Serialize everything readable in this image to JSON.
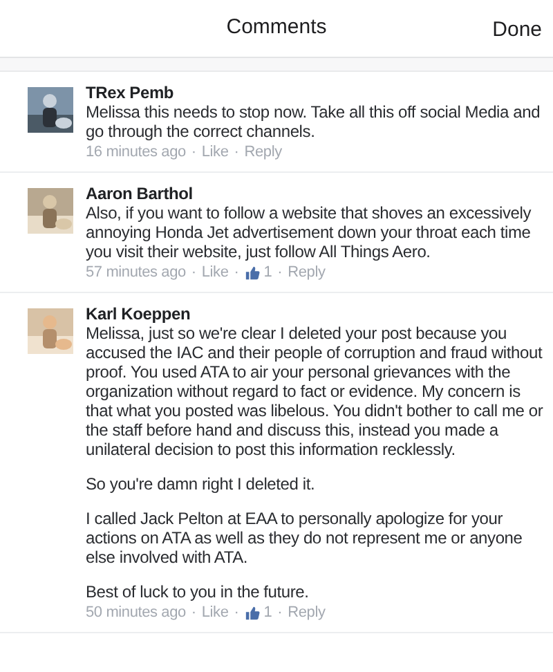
{
  "header": {
    "title": "Comments",
    "done_label": "Done"
  },
  "comments": [
    {
      "author": "TRex Pemb",
      "paragraphs": [
        "Melissa this needs to stop now. Take all this off social Media and go through the correct channels."
      ],
      "meta": [
        {
          "kind": "time",
          "text": "16 minutes ago"
        },
        {
          "kind": "sep",
          "text": "·"
        },
        {
          "kind": "link",
          "text": "Like"
        },
        {
          "kind": "sep",
          "text": "·"
        },
        {
          "kind": "link",
          "text": "Reply"
        }
      ]
    },
    {
      "author": "Aaron Barthol",
      "paragraphs": [
        "Also, if you want to follow a website that shoves an excessively annoying Honda Jet advertisement down your throat each time you visit their website, just follow All Things Aero."
      ],
      "meta": [
        {
          "kind": "time",
          "text": "57 minutes ago"
        },
        {
          "kind": "sep",
          "text": "·"
        },
        {
          "kind": "link",
          "text": "Like"
        },
        {
          "kind": "sep",
          "text": "·"
        },
        {
          "kind": "likes",
          "text": "1"
        },
        {
          "kind": "sep",
          "text": "·"
        },
        {
          "kind": "link",
          "text": "Reply"
        }
      ]
    },
    {
      "author": "Karl Koeppen",
      "paragraphs": [
        "Melissa, just so we're clear I deleted your post because you accused the IAC and their people of corruption and fraud without proof. You used ATA to air your personal grievances with the organization without regard to fact or evidence. My concern is that what you posted was libelous. You didn't bother to call me or the staff before hand and discuss this, instead you made a unilateral decision to post this information recklessly.",
        "So you're damn right I deleted it.",
        "I called Jack Pelton at EAA to personally apologize for your actions on ATA as well as they do not represent me or anyone else involved with ATA.",
        "Best of luck to you in the future."
      ],
      "meta": [
        {
          "kind": "time",
          "text": "50 minutes ago"
        },
        {
          "kind": "sep",
          "text": "·"
        },
        {
          "kind": "link",
          "text": "Like"
        },
        {
          "kind": "sep",
          "text": "·"
        },
        {
          "kind": "likes",
          "text": "1"
        },
        {
          "kind": "sep",
          "text": "·"
        },
        {
          "kind": "link",
          "text": "Reply"
        }
      ]
    }
  ]
}
